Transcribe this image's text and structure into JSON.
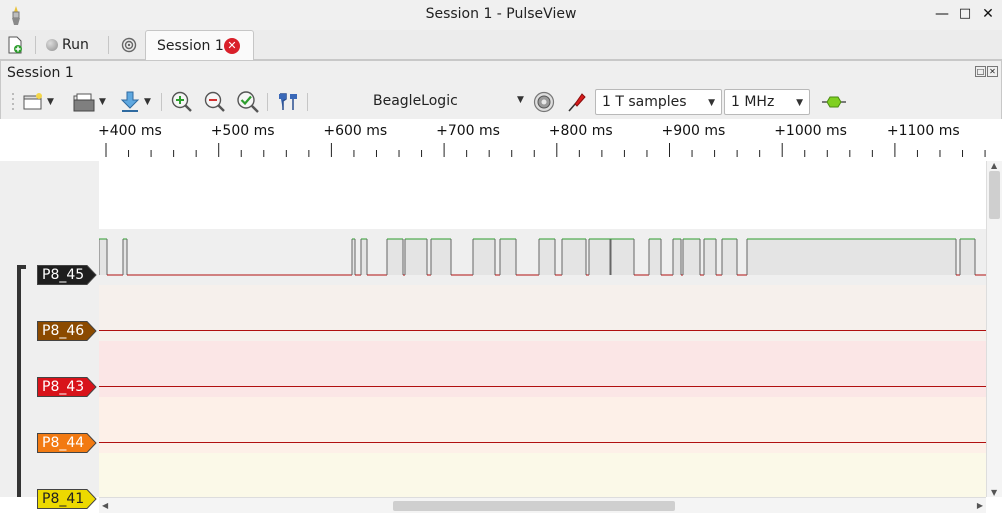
{
  "window": {
    "title": "Session 1 - PulseView"
  },
  "tabbar": {
    "run_label": "Run",
    "session_tab_label": "Session 1"
  },
  "session": {
    "title": "Session 1",
    "device": "BeagleLogic",
    "samples": "1 T samples",
    "samplerate": "1 MHz"
  },
  "ruler": {
    "labels": [
      "+400 ms",
      "+500 ms",
      "+600 ms",
      "+700 ms",
      "+800 ms",
      "+900 ms",
      "+1000 ms",
      "+1100 ms"
    ]
  },
  "channels": [
    {
      "name": "P8_45",
      "color": "#1e1e1e",
      "text_color": "#ffffff",
      "bg": "#f5f5f5"
    },
    {
      "name": "P8_46",
      "color": "#8b4a00",
      "text_color": "#ffffff",
      "bg": "#f6f0ec"
    },
    {
      "name": "P8_43",
      "color": "#d8131a",
      "text_color": "#ffffff",
      "bg": "#fbe6e6"
    },
    {
      "name": "P8_44",
      "color": "#f27a12",
      "text_color": "#ffffff",
      "bg": "#fdf0e8"
    },
    {
      "name": "P8_41",
      "color": "#ecd900",
      "text_color": "#222222",
      "bg": "#fbf9e8"
    }
  ],
  "colors": {
    "signal_high": "#2e9e2e",
    "signal_low": "#b01010",
    "high_fill": "#e4e4e4"
  },
  "icons": {
    "new_session": "new-session-icon",
    "run": "run-indicator-icon",
    "decoder": "decoder-icon",
    "open": "open-file-icon",
    "save": "save-icon",
    "zoom_in": "zoom-in-icon",
    "zoom_out": "zoom-out-icon",
    "zoom_fit": "zoom-fit-icon",
    "cursors": "cursors-icon",
    "configure": "configure-device-icon",
    "probes": "probe-icon",
    "add_decoder": "add-decoder-icon"
  }
}
